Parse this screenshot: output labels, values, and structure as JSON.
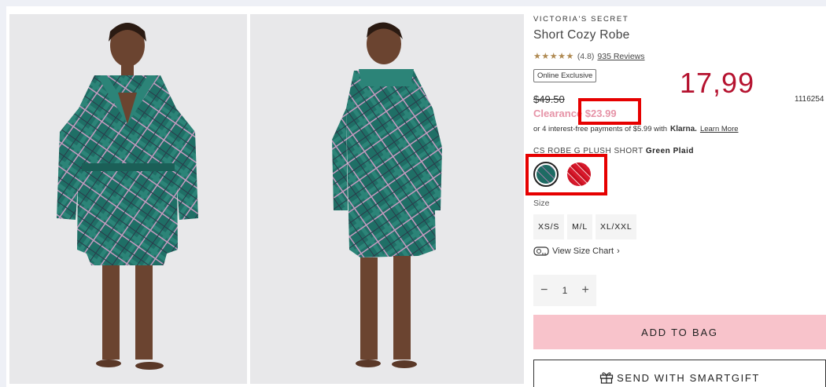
{
  "product": {
    "brand": "VICTORIA'S SECRET",
    "name": "Short Cozy Robe",
    "stars": "★★★★★",
    "rating_text": "(4.8)",
    "reviews": "935 Reviews",
    "badge": "Online Exclusive",
    "sku_partial": "1116254",
    "original_price": "$49.50",
    "clearance_label": "Clearance",
    "clearance_price": "$23.99",
    "installments_text": "or 4 interest-free payments of $5.99 with",
    "klarna": "Klarna.",
    "learn_more": "Learn More",
    "swatch_prefix": "CS ROBE G PLUSH SHORT",
    "swatch_color": "Green Plaid",
    "size_label": "Size",
    "sizes": [
      "XS/S",
      "M/L",
      "XL/XXL"
    ],
    "view_size_chart": "View Size Chart",
    "quantity": "1",
    "add_to_bag": "ADD TO BAG",
    "send_gift": "SEND WITH SMARTGIFT"
  },
  "annotation": {
    "handwritten_price": "17,99",
    "color": "#b5122f"
  },
  "icons": {
    "minus": "−",
    "plus": "+",
    "chevron": "›"
  }
}
